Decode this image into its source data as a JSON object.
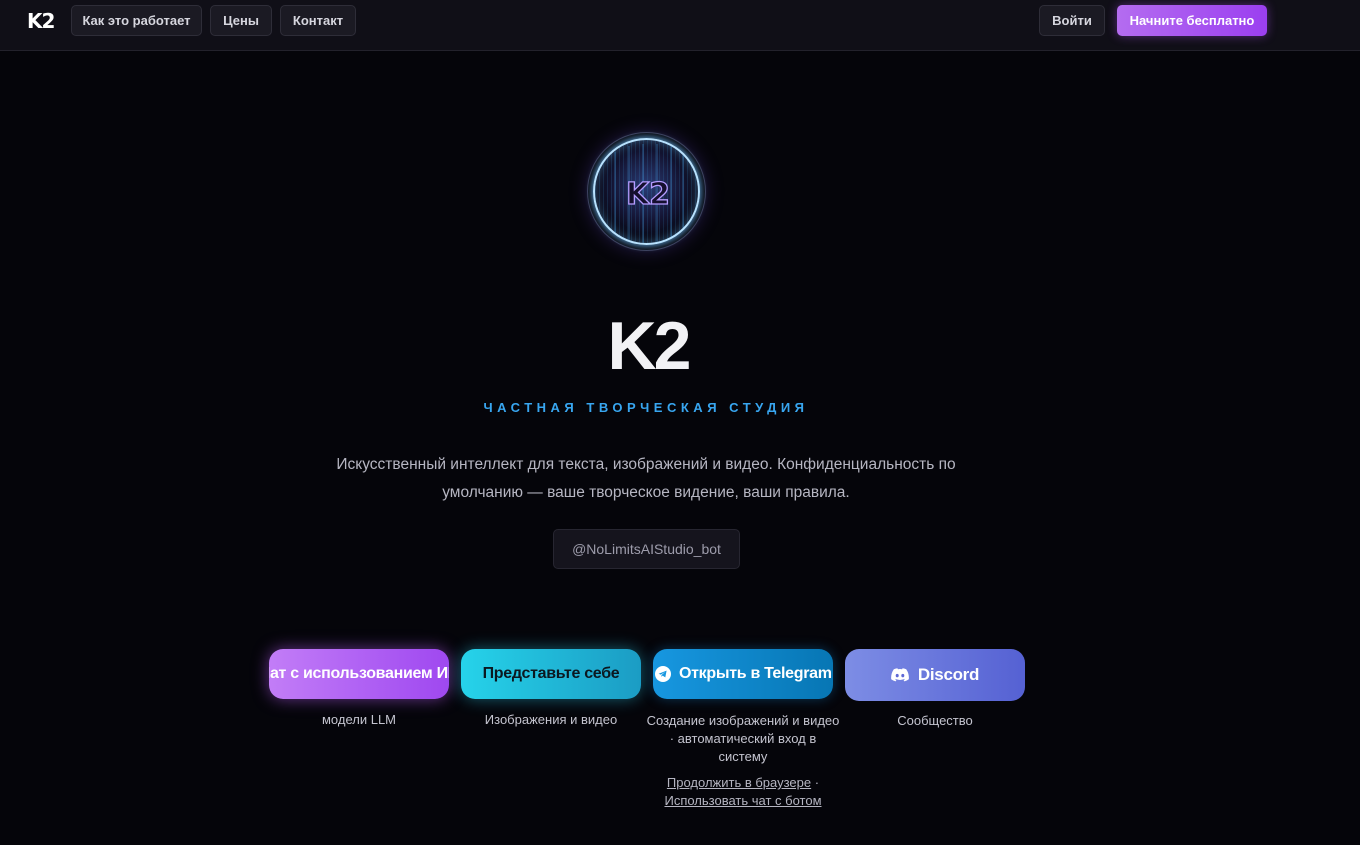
{
  "header": {
    "logo": "K2",
    "nav": [
      "Как это работает",
      "Цены",
      "Контакт"
    ],
    "login": "Войти",
    "cta": "Начните бесплатно"
  },
  "hero": {
    "avatar_text": "K2",
    "title": "K2",
    "subtitle": "ЧАСТНАЯ ТВОРЧЕСКАЯ СТУДИЯ",
    "description": "Искусственный интеллект для текста, изображений и видео. Конфиденциальность по умолчанию — ваше творческое видение, ваши правила.",
    "bot_handle": "@NoLimitsAIStudio_bot"
  },
  "actions": [
    {
      "label": "Чат с использованием ИИ",
      "caption": "модели LLM",
      "icon": ""
    },
    {
      "label": "Представьте себе",
      "caption": "Изображения и видео",
      "icon": ""
    },
    {
      "label": "Открыть в Telegram",
      "caption": "Создание изображений и видео · автоматический вход в систему",
      "icon": "telegram-icon"
    },
    {
      "label": "Discord",
      "caption": "Сообщество",
      "icon": "discord-icon"
    }
  ],
  "telegram_links": {
    "browser": "Продолжить в браузере",
    "separator": "·",
    "bot_chat": "Использовать чат с ботом"
  },
  "colors": {
    "background": "#05050a",
    "accent_purple": "#a34cf0",
    "accent_cyan": "#26d3ea",
    "telegram_blue": "#1797e0",
    "discord_blurple": "#5865f2",
    "subtitle_blue": "#38a6f0"
  }
}
